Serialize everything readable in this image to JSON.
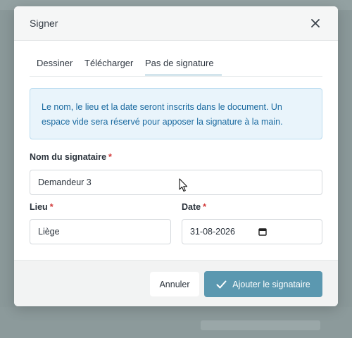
{
  "dialog": {
    "title": "Signer",
    "close_icon": "close-icon"
  },
  "tabs": [
    {
      "label": "Dessiner",
      "active": false
    },
    {
      "label": "Télécharger",
      "active": false
    },
    {
      "label": "Pas de signature",
      "active": true
    }
  ],
  "info": {
    "line1": "Le nom, le lieu et la date seront inscrits dans le document. Un",
    "line2": "espace vide sera réservé pour apposer la signature à la main."
  },
  "form": {
    "signer_name": {
      "label": "Nom du signataire",
      "required_mark": "*",
      "value": "Demandeur 3"
    },
    "place": {
      "label": "Lieu",
      "required_mark": "*",
      "value": "Liège"
    },
    "date": {
      "label": "Date",
      "required_mark": "*",
      "value": "31-08-2026",
      "icon": "calendar-icon"
    }
  },
  "footer": {
    "cancel_label": "Annuler",
    "submit_label": "Ajouter le signataire",
    "submit_icon": "check-icon"
  },
  "colors": {
    "primary": "#5b98b0",
    "info_bg": "#e9f4fb",
    "info_text": "#1a6aa0",
    "required": "#d23a3a"
  }
}
